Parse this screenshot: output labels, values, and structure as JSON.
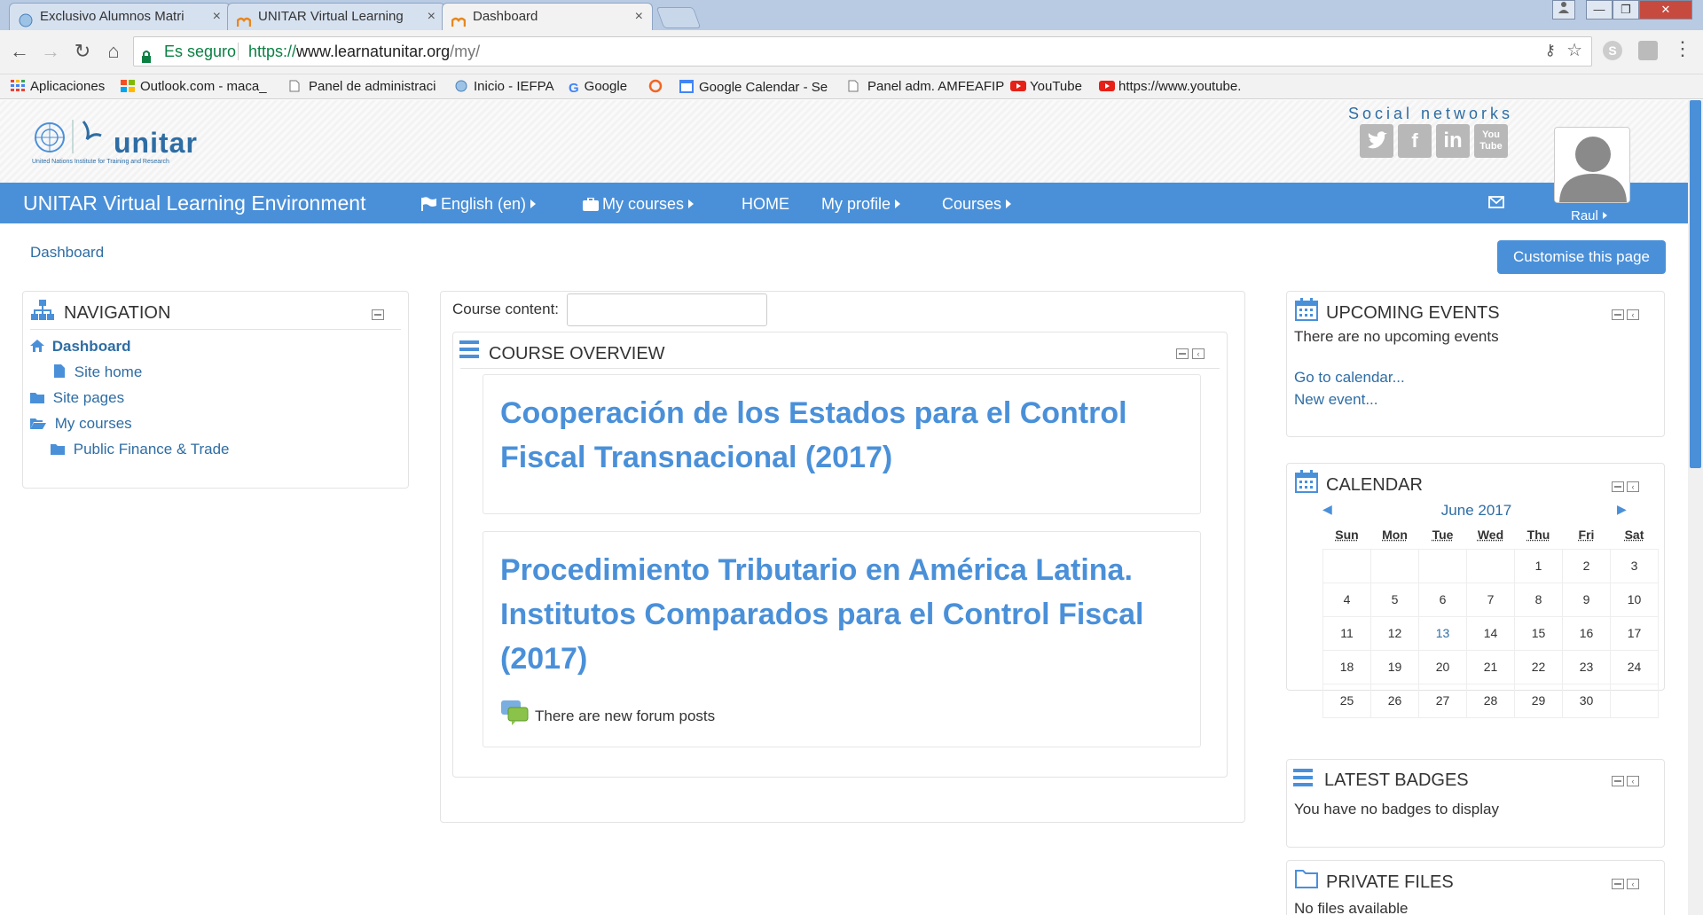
{
  "browser": {
    "tabs": [
      {
        "label": "Exclusivo Alumnos Matri"
      },
      {
        "label": "UNITAR Virtual Learning"
      },
      {
        "label": "Dashboard"
      }
    ],
    "secure_label": "Es seguro",
    "url_scheme": "https://",
    "url_host": "www.learnatunitar.org",
    "url_path": "/my/",
    "bookmarks": [
      {
        "label": "Aplicaciones"
      },
      {
        "label": "Outlook.com - maca_"
      },
      {
        "label": "Panel de administraci"
      },
      {
        "label": "Inicio - IEFPA"
      },
      {
        "label": "Google"
      },
      {
        "label": "Google Calendar - Se"
      },
      {
        "label": "Panel adm. AMFEAFIP"
      },
      {
        "label": "YouTube"
      },
      {
        "label": "https://www.youtube."
      }
    ]
  },
  "header": {
    "logo_text": "unitar",
    "logo_subtext": "United Nations Institute for Training and Research",
    "social_title": "Social networks",
    "social": [
      "twitter",
      "facebook",
      "linkedin",
      "youtube"
    ],
    "youtube_label": "You\nTube"
  },
  "navbar": {
    "site_name": "UNITAR Virtual Learning Environment",
    "language": "English (en)",
    "my_courses": "My courses",
    "home": "HOME",
    "my_profile": "My profile",
    "courses": "Courses",
    "user": "Raul"
  },
  "breadcrumb": "Dashboard",
  "customise_button": "Customise this page",
  "navigation_block": {
    "title": "NAVIGATION",
    "items": [
      {
        "label": "Dashboard"
      },
      {
        "label": "Site home"
      },
      {
        "label": "Site pages"
      },
      {
        "label": "My courses"
      },
      {
        "label": "Public Finance & Trade"
      }
    ]
  },
  "main": {
    "course_content_label": "Course content:",
    "course_content_value": "",
    "overview_title": "COURSE OVERVIEW",
    "courses": [
      {
        "title_line1": "Cooperación de los Estados para el Control",
        "title_line2": "Fiscal Transnacional (2017)"
      },
      {
        "title_line1": "Procedimiento Tributario en América Latina.",
        "title_line2": "Institutos Comparados para el Control Fiscal",
        "title_line3": "(2017)",
        "forum_note": "There are new forum posts"
      }
    ]
  },
  "upcoming_events": {
    "title": "UPCOMING EVENTS",
    "empty_text": "There are no upcoming events",
    "go_to_calendar": "Go to calendar...",
    "new_event": "New event..."
  },
  "calendar": {
    "title": "CALENDAR",
    "month": "June 2017",
    "weekdays": [
      "Sun",
      "Mon",
      "Tue",
      "Wed",
      "Thu",
      "Fri",
      "Sat"
    ],
    "weeks": [
      [
        "",
        "",
        "",
        "",
        "1",
        "2",
        "3"
      ],
      [
        "4",
        "5",
        "6",
        "7",
        "8",
        "9",
        "10"
      ],
      [
        "11",
        "12",
        "13",
        "14",
        "15",
        "16",
        "17"
      ],
      [
        "18",
        "19",
        "20",
        "21",
        "22",
        "23",
        "24"
      ],
      [
        "25",
        "26",
        "27",
        "28",
        "29",
        "30",
        ""
      ]
    ],
    "today": "13"
  },
  "latest_badges": {
    "title": "LATEST BADGES",
    "empty_text": "You have no badges to display"
  },
  "private_files": {
    "title": "PRIVATE FILES",
    "empty_text": "No files available"
  },
  "colors": {
    "brand": "#4a90d9",
    "link": "#2e6da4"
  }
}
